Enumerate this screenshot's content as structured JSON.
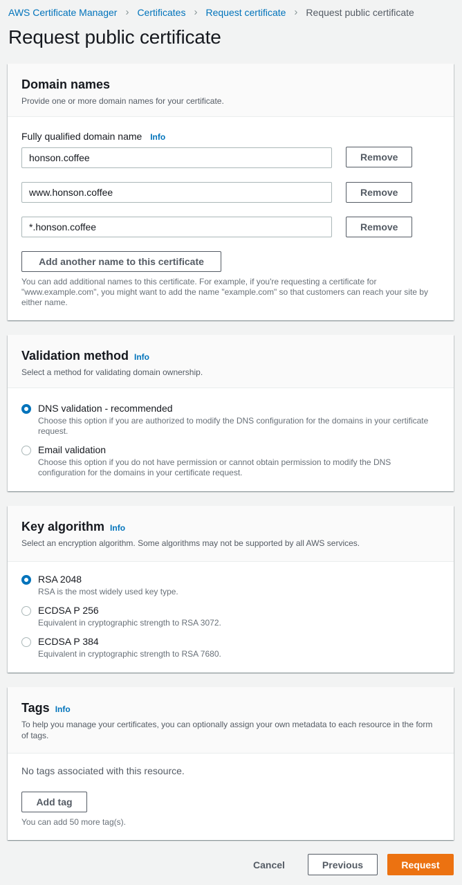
{
  "breadcrumb": {
    "items": [
      "AWS Certificate Manager",
      "Certificates",
      "Request certificate"
    ],
    "current": "Request public certificate"
  },
  "page_title": "Request public certificate",
  "domain_names": {
    "title": "Domain names",
    "description": "Provide one or more domain names for your certificate.",
    "field_label": "Fully qualified domain name",
    "info": "Info",
    "entries": [
      {
        "value": "honson.coffee",
        "remove_label": "Remove"
      },
      {
        "value": "www.honson.coffee",
        "remove_label": "Remove"
      },
      {
        "value": "*.honson.coffee",
        "remove_label": "Remove"
      }
    ],
    "add_button": "Add another name to this certificate",
    "hint": "You can add additional names to this certificate. For example, if you're requesting a certificate for \"www.example.com\", you might want to add the name \"example.com\" so that customers can reach your site by either name."
  },
  "validation": {
    "title": "Validation method",
    "info": "Info",
    "description": "Select a method for validating domain ownership.",
    "options": [
      {
        "label": "DNS validation - recommended",
        "description": "Choose this option if you are authorized to modify the DNS configuration for the domains in your certificate request.",
        "selected": true
      },
      {
        "label": "Email validation",
        "description": "Choose this option if you do not have permission or cannot obtain permission to modify the DNS configuration for the domains in your certificate request.",
        "selected": false
      }
    ]
  },
  "key_algorithm": {
    "title": "Key algorithm",
    "info": "Info",
    "description": "Select an encryption algorithm. Some algorithms may not be supported by all AWS services.",
    "options": [
      {
        "label": "RSA 2048",
        "description": "RSA is the most widely used key type.",
        "selected": true
      },
      {
        "label": "ECDSA P 256",
        "description": "Equivalent in cryptographic strength to RSA 3072.",
        "selected": false
      },
      {
        "label": "ECDSA P 384",
        "description": "Equivalent in cryptographic strength to RSA 7680.",
        "selected": false
      }
    ]
  },
  "tags": {
    "title": "Tags",
    "info": "Info",
    "description": "To help you manage your certificates, you can optionally assign your own metadata to each resource in the form of tags.",
    "empty_text": "No tags associated with this resource.",
    "add_button": "Add tag",
    "hint": "You can add 50 more tag(s)."
  },
  "footer": {
    "cancel": "Cancel",
    "previous": "Previous",
    "request": "Request"
  },
  "colors": {
    "link": "#0073bb",
    "primary": "#ec7211",
    "background": "#f2f3f3"
  }
}
